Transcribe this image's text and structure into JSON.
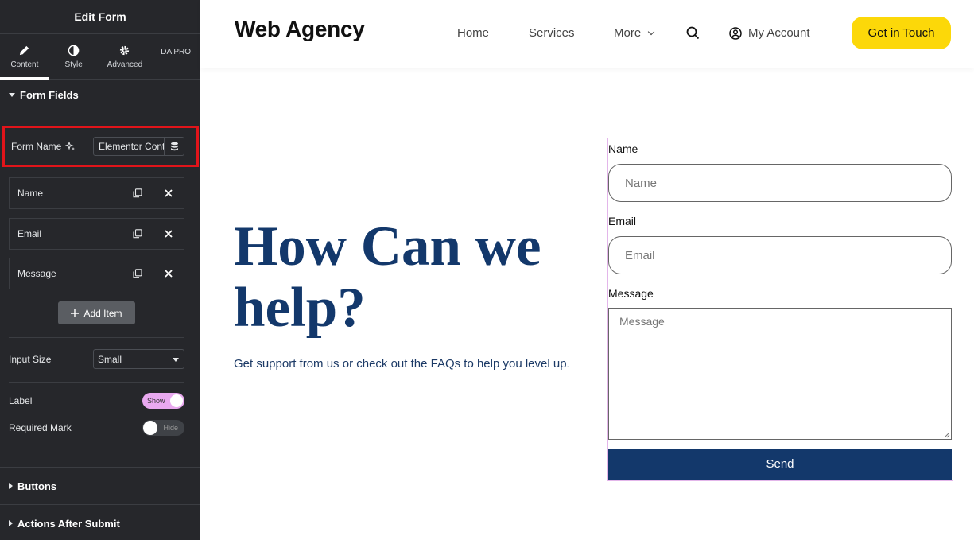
{
  "panel": {
    "title": "Edit Form",
    "tabs": [
      {
        "label": "Content",
        "icon": "pencil-icon"
      },
      {
        "label": "Style",
        "icon": "half-circle-icon"
      },
      {
        "label": "Advanced",
        "icon": "gear-icon"
      },
      {
        "label": "DA PRO",
        "icon": ""
      }
    ],
    "active_tab": "Content",
    "form_fields_section": "Form Fields",
    "form_name_label": "Form Name",
    "form_name_value": "Elementor Contact Form",
    "fields": [
      {
        "label": "Name"
      },
      {
        "label": "Email"
      },
      {
        "label": "Message"
      }
    ],
    "add_item_label": "Add Item",
    "input_size_label": "Input Size",
    "input_size_value": "Small",
    "label_label": "Label",
    "label_toggle": "Show",
    "required_mark_label": "Required Mark",
    "required_mark_toggle": "Hide",
    "buttons_section": "Buttons",
    "actions_section": "Actions After Submit"
  },
  "site": {
    "logo": "Web Agency",
    "nav": [
      "Home",
      "Services",
      "More"
    ],
    "account_label": "My Account",
    "cta_label": "Get in Touch",
    "cta_color": "#fcd809"
  },
  "hero": {
    "title": "How Can we help?",
    "subtitle": "Get support from us or check out the FAQs to help you level up."
  },
  "form": {
    "name_label": "Name",
    "name_placeholder": "Name",
    "email_label": "Email",
    "email_placeholder": "Email",
    "message_label": "Message",
    "message_placeholder": "Message",
    "submit_label": "Send",
    "submit_color": "#13386b"
  },
  "colors": {
    "panel_bg": "#26272b",
    "highlight": "#e1141a",
    "heading": "#13386b",
    "toggle_on": "#e9a9f0"
  }
}
